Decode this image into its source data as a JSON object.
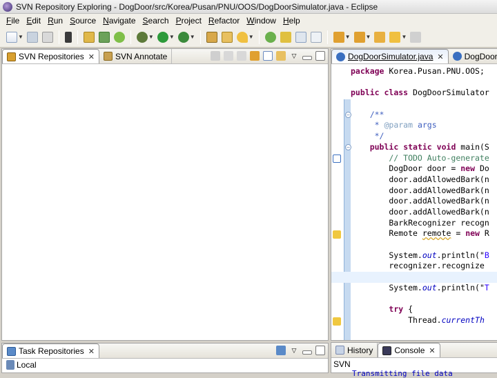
{
  "window": {
    "title": "SVN Repository Exploring - DogDoor/src/Korea/Pusan/PNU/OOS/DogDoorSimulator.java - Eclipse"
  },
  "menu": {
    "items": [
      {
        "mnemonic": "F",
        "rest": "ile"
      },
      {
        "mnemonic": "E",
        "rest": "dit"
      },
      {
        "mnemonic": "R",
        "rest": "un"
      },
      {
        "mnemonic": "S",
        "rest": "ource"
      },
      {
        "mnemonic": "N",
        "rest": "avigate"
      },
      {
        "mnemonic": "S",
        "rest": "earch"
      },
      {
        "mnemonic": "P",
        "rest": "roject"
      },
      {
        "mnemonic": "R",
        "rest": "efactor"
      },
      {
        "mnemonic": "W",
        "rest": "indow"
      },
      {
        "mnemonic": "H",
        "rest": "elp"
      }
    ]
  },
  "colors": {
    "accent": "#4a73b8",
    "keyword": "#7f0055",
    "comment": "#3f7f5f",
    "javadoc": "#3f5fbf",
    "string": "#2a00ff"
  },
  "left_top_panel": {
    "tabs": [
      {
        "label": "SVN Repositories",
        "icon": "svn-repo-icon",
        "close": "✕"
      },
      {
        "label": "SVN Annotate",
        "icon": "svn-annotate-icon",
        "close": ""
      }
    ]
  },
  "left_bottom_panel": {
    "tabs": [
      {
        "label": "Task Repositories",
        "icon": "task-repo-icon",
        "close": "✕"
      }
    ],
    "items": [
      {
        "label": "Local",
        "icon": "local-repo-icon"
      }
    ]
  },
  "editor": {
    "tabs": [
      {
        "label": "DogDoorSimulator.java",
        "close": "✕"
      },
      {
        "label": "DogDoor",
        "close": ""
      }
    ],
    "lines": [
      {
        "segments": [
          {
            "t": "package",
            "c": "kw"
          },
          {
            "t": " Korea.Pusan.PNU.OOS;",
            "c": ""
          }
        ]
      },
      {
        "segments": []
      },
      {
        "segments": [
          {
            "t": "public",
            "c": "kw"
          },
          {
            "t": " ",
            "c": ""
          },
          {
            "t": "class",
            "c": "kw"
          },
          {
            "t": " DogDoorSimulator",
            "c": ""
          }
        ]
      },
      {
        "segments": []
      },
      {
        "segments": [
          {
            "t": "    /**",
            "c": "cm"
          }
        ]
      },
      {
        "segments": [
          {
            "t": "     * ",
            "c": "cm"
          },
          {
            "t": "@param",
            "c": "jd"
          },
          {
            "t": " args",
            "c": "cm"
          }
        ]
      },
      {
        "segments": [
          {
            "t": "     */",
            "c": "cm"
          }
        ]
      },
      {
        "segments": [
          {
            "t": "    ",
            "c": ""
          },
          {
            "t": "public",
            "c": "kw"
          },
          {
            "t": " ",
            "c": ""
          },
          {
            "t": "static",
            "c": "kw"
          },
          {
            "t": " ",
            "c": ""
          },
          {
            "t": "void",
            "c": "kw"
          },
          {
            "t": " main(S",
            "c": ""
          }
        ]
      },
      {
        "segments": [
          {
            "t": "        // TODO Auto-generate",
            "c": "cm2"
          }
        ]
      },
      {
        "segments": [
          {
            "t": "        DogDoor door = ",
            "c": ""
          },
          {
            "t": "new",
            "c": "kw"
          },
          {
            "t": " Do",
            "c": ""
          }
        ]
      },
      {
        "segments": [
          {
            "t": "        door.addAllowedBark(n",
            "c": ""
          }
        ]
      },
      {
        "segments": [
          {
            "t": "        door.addAllowedBark(n",
            "c": ""
          }
        ]
      },
      {
        "segments": [
          {
            "t": "        door.addAllowedBark(n",
            "c": ""
          }
        ]
      },
      {
        "segments": [
          {
            "t": "        door.addAllowedBark(n",
            "c": ""
          }
        ]
      },
      {
        "segments": [
          {
            "t": "        BarkRecognizer recogn",
            "c": ""
          }
        ]
      },
      {
        "segments": [
          {
            "t": "        Remote ",
            "c": ""
          },
          {
            "t": "remote",
            "c": "squig"
          },
          {
            "t": " = ",
            "c": ""
          },
          {
            "t": "new",
            "c": "kw"
          },
          {
            "t": " R",
            "c": ""
          }
        ]
      },
      {
        "segments": []
      },
      {
        "segments": [
          {
            "t": "        System.",
            "c": ""
          },
          {
            "t": "out",
            "c": "it"
          },
          {
            "t": ".println(\"",
            "c": ""
          },
          {
            "t": "B",
            "c": "st"
          }
        ]
      },
      {
        "segments": [
          {
            "t": "        recognizer.recognize",
            "c": ""
          }
        ]
      },
      {
        "segments": [],
        "current": true
      },
      {
        "segments": [
          {
            "t": "        System.",
            "c": ""
          },
          {
            "t": "out",
            "c": "it"
          },
          {
            "t": ".println(\"",
            "c": ""
          },
          {
            "t": "T",
            "c": "st"
          }
        ]
      },
      {
        "segments": []
      },
      {
        "segments": [
          {
            "t": "        ",
            "c": ""
          },
          {
            "t": "try",
            "c": "kw"
          },
          {
            "t": " {",
            "c": ""
          }
        ]
      },
      {
        "segments": [
          {
            "t": "            Thread.",
            "c": ""
          },
          {
            "t": "currentTh",
            "c": "it"
          }
        ]
      }
    ]
  },
  "bottom_right_panel": {
    "tabs": [
      {
        "label": "History",
        "icon": "history-icon",
        "close": ""
      },
      {
        "label": "Console",
        "icon": "console-icon",
        "close": "✕"
      }
    ],
    "console_title": "SVN",
    "console_line": "Transmitting file data"
  }
}
